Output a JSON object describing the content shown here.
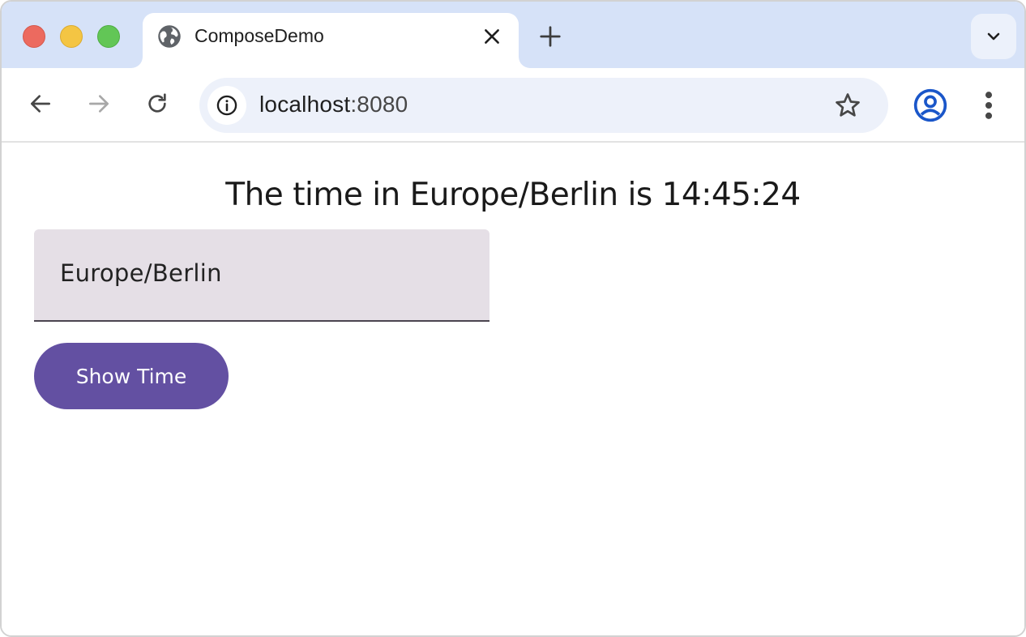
{
  "browser": {
    "tab": {
      "title": "ComposeDemo",
      "icon": "globe-icon"
    },
    "address_bar": {
      "host": "localhost",
      "port": ":8080"
    }
  },
  "page": {
    "time_message": "The time in Europe/Berlin is 14:45:24",
    "timezone_field": {
      "value": "Europe/Berlin"
    },
    "show_time_button": {
      "label": "Show Time"
    }
  },
  "colors": {
    "tabstrip": "#d6e2f8",
    "omnibox": "#edf1fa",
    "text_field": "#e5dfe6",
    "button": "#6350a2",
    "profile_icon": "#1a56c9"
  }
}
